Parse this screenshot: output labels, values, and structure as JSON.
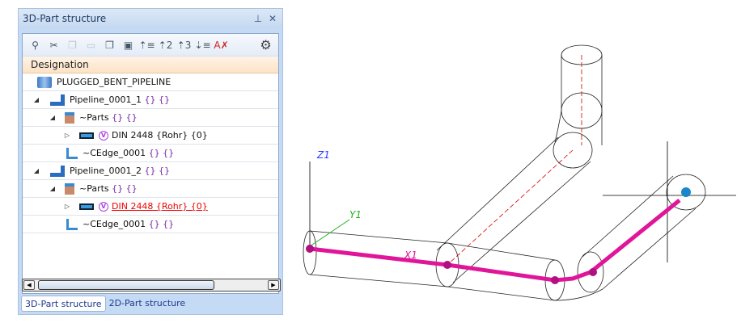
{
  "panel": {
    "title": "3D-Part structure",
    "pin": "📌",
    "close": "✕"
  },
  "toolbar": {
    "icons": [
      "search-icon",
      "cut-icon",
      "copy-icon",
      "paste-icon",
      "copy-special-icon",
      "paste-special-icon",
      "expand-level-1-icon",
      "expand-level-2-icon",
      "expand-level-3-icon",
      "collapse-all-icon",
      "clear-sort-icon",
      "settings-icon"
    ]
  },
  "tree": {
    "header": "Designation",
    "rows": [
      {
        "name": "PLUGGED_BENT_PIPELINE",
        "suffix": ""
      },
      {
        "name": "Pipeline_0001_1",
        "suffix": "{} {}"
      },
      {
        "name": "~Parts",
        "suffix": "{} {}"
      },
      {
        "name": "DIN 2448 {Rohr} {0}",
        "suffix": "",
        "badge": "V"
      },
      {
        "name": "~CEdge_0001",
        "suffix": "{} {}"
      },
      {
        "name": "Pipeline_0001_2",
        "suffix": "{} {}"
      },
      {
        "name": "~Parts",
        "suffix": "{} {}"
      },
      {
        "name": "DIN 2448 {Rohr} {0}",
        "suffix": "",
        "badge": "V"
      },
      {
        "name": "~CEdge_0001",
        "suffix": "{} {}"
      }
    ]
  },
  "tabs": [
    "3D-Part structure",
    "2D-Part structure"
  ],
  "viewport": {
    "axes": {
      "z": "Z1",
      "y": "Y1",
      "x": "X1"
    },
    "colors": {
      "pipe": "#e0169a",
      "axis": "#2a3cff",
      "y_axis": "#20b020",
      "center": "#d00000"
    }
  }
}
